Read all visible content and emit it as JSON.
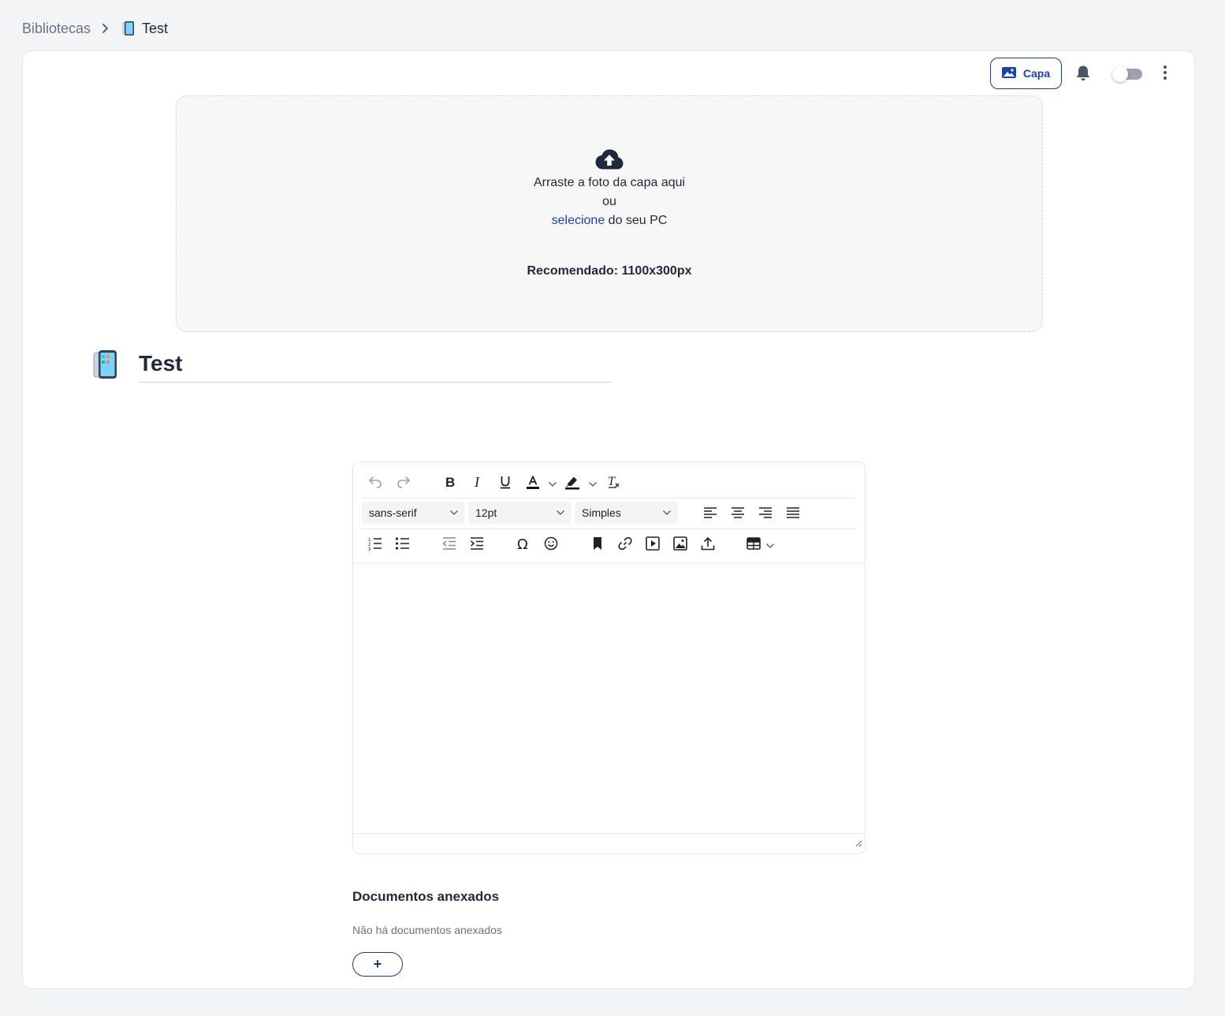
{
  "breadcrumb": {
    "root": "Bibliotecas",
    "current": "Test",
    "emoji_icon": "mobile-phone-icon"
  },
  "header_actions": {
    "capa_label": "Capa",
    "notifications_icon": "bell-icon",
    "toggle_on": false,
    "more_icon": "vertical-ellipsis-icon"
  },
  "cover_upload": {
    "icon": "cloud-upload-icon",
    "line1": "Arraste a foto da capa aqui",
    "line2": "ou",
    "link": "selecione",
    "line3_rest": " do seu PC",
    "recommended": "Recomendado: 1100x300px"
  },
  "page": {
    "title": "Test",
    "emoji_icon": "mobile-phone-icon"
  },
  "editor": {
    "font_family": "sans-serif",
    "font_size": "12pt",
    "line_spacing": "Simples",
    "content": ""
  },
  "attachments": {
    "title": "Documentos anexados",
    "empty_text": "Não há documentos anexados",
    "add_label": "+"
  },
  "colors": {
    "accent": "#1e40af",
    "text": "#1f2937",
    "muted": "#6b7280",
    "background": "#f3f4f6"
  }
}
